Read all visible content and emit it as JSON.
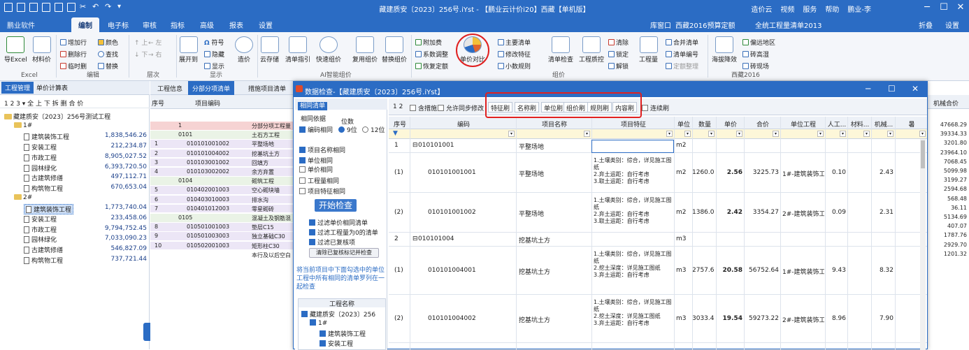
{
  "window": {
    "title": "藏建质安〔2023〕256号.iYst - 【鹏业云计价i20】西藏【单机版】",
    "right_items": [
      "造价云",
      "视频",
      "服务",
      "帮助",
      "鹏业-李"
    ]
  },
  "menu": {
    "logo": "鹏业软件",
    "tabs": [
      "编制",
      "电子标",
      "审核",
      "指标",
      "高级",
      "报表",
      "设置"
    ],
    "right": [
      "库窗口",
      "西藏2016预算定额",
      "全统工程量清单2013",
      "折叠",
      "设置"
    ]
  },
  "ribbon": {
    "excel": {
      "items": [
        "导Excel",
        "材料价"
      ],
      "group": "Excel"
    },
    "edit": {
      "items": [
        "增加行",
        "删除行",
        "临时删",
        "颜色",
        "查找",
        "替换"
      ],
      "group": "编辑"
    },
    "level": {
      "items": [
        "上",
        "下",
        "左",
        "右"
      ],
      "group": "层次"
    },
    "display": {
      "items": [
        "展开到",
        "符号",
        "隐藏",
        "显示"
      ],
      "group": "显示"
    },
    "price": {
      "items": [
        "造价"
      ]
    },
    "ai": {
      "items": [
        "云存储",
        "清单指引",
        "快速组价",
        "复用组价",
        "替换组价"
      ],
      "group": "AI智能组价"
    },
    "group_price": {
      "items": [
        "附加费",
        "系数调整",
        "恢复定额",
        "单价对比",
        "主要清单",
        "修改特征",
        "小数规则",
        "清单检查",
        "工程质控",
        "清除",
        "锁定",
        "解锁",
        "工程量",
        "合并清单",
        "清单编号",
        "定额整理"
      ],
      "group": "组价"
    },
    "xizang": {
      "items": [
        "海拔降效",
        "偏远地区",
        "砖高湿",
        "砖现场"
      ],
      "group": "西藏2016"
    }
  },
  "left_panel": {
    "tabs": [
      "工程管理",
      "单价计算表"
    ],
    "tools": "1 2 3 ▾ 全 上 下 拆 删 合 价",
    "tree": [
      {
        "label": "藏建质安〔2023〕256号测试工程",
        "amount": "",
        "indent": 0,
        "type": "folder"
      },
      {
        "label": "1#",
        "amount": "",
        "indent": 1,
        "type": "folder"
      },
      {
        "label": "建筑装饰工程",
        "amount": "1,838,546.26",
        "indent": 2,
        "type": "doc"
      },
      {
        "label": "安装工程",
        "amount": "212,234.87",
        "indent": 2,
        "type": "doc"
      },
      {
        "label": "市政工程",
        "amount": "8,905,027.52",
        "indent": 2,
        "type": "doc"
      },
      {
        "label": "园林绿化",
        "amount": "6,393,720.50",
        "indent": 2,
        "type": "doc"
      },
      {
        "label": "古建筑修缮",
        "amount": "497,112.71",
        "indent": 2,
        "type": "doc"
      },
      {
        "label": "构筑物工程",
        "amount": "670,653.04",
        "indent": 2,
        "type": "doc"
      },
      {
        "label": "2#",
        "amount": "",
        "indent": 1,
        "type": "folder"
      },
      {
        "label": "建筑装饰工程",
        "amount": "1,773,740.04",
        "indent": 2,
        "type": "doc",
        "selected": true
      },
      {
        "label": "安装工程",
        "amount": "233,458.06",
        "indent": 2,
        "type": "doc"
      },
      {
        "label": "市政工程",
        "amount": "9,794,752.45",
        "indent": 2,
        "type": "doc"
      },
      {
        "label": "园林绿化",
        "amount": "7,033,090.23",
        "indent": 2,
        "type": "doc"
      },
      {
        "label": "古建筑修缮",
        "amount": "546,827.09",
        "indent": 2,
        "type": "doc"
      },
      {
        "label": "构筑物工程",
        "amount": "737,721.44",
        "indent": 2,
        "type": "doc"
      }
    ]
  },
  "mid_panel": {
    "tabs": [
      "工程信息",
      "分部分项清单",
      "措施项目清单"
    ],
    "headers": [
      "序号",
      "项目编码"
    ],
    "rows": [
      {
        "seq": "",
        "code": "1",
        "name": "分部分项工程量"
      },
      {
        "seq": "",
        "code": "0101",
        "name": "土石方工程"
      },
      {
        "seq": "1",
        "code": "010101001002",
        "name": "平整场地"
      },
      {
        "seq": "2",
        "code": "010101004002",
        "name": "挖基坑土方"
      },
      {
        "seq": "3",
        "code": "010103001002",
        "name": "回填方"
      },
      {
        "seq": "4",
        "code": "010103002002",
        "name": "余方弃置"
      },
      {
        "seq": "",
        "code": "0104",
        "name": "砌筑工程"
      },
      {
        "seq": "5",
        "code": "010402001003",
        "name": "空心砌块墙"
      },
      {
        "seq": "6",
        "code": "010403010003",
        "name": "排水沟"
      },
      {
        "seq": "7",
        "code": "010401012003",
        "name": "零星砌砖"
      },
      {
        "seq": "",
        "code": "0105",
        "name": "混凝土及钢筋混"
      },
      {
        "seq": "8",
        "code": "010501001003",
        "name": "垫层C15"
      },
      {
        "seq": "9",
        "code": "010501003003",
        "name": "独立基础C30"
      },
      {
        "seq": "10",
        "code": "010502001003",
        "name": "矩形柱C30"
      },
      {
        "seq": "",
        "code": "",
        "name": "本行及以后空白"
      }
    ]
  },
  "right_strip": {
    "header": "机械合价",
    "values": [
      "47668.29",
      "39334.33",
      "3201.80",
      "23964.10",
      "7068.45",
      "5099.98",
      "3199.27",
      "2594.68",
      "568.48",
      "36.11",
      "5134.69",
      "407.07",
      "1787.76",
      "2929.70",
      "1201.32"
    ]
  },
  "dialog": {
    "title": "数据检查-【藏建质安〔2023〕256号.iYst】",
    "left": {
      "head": "相同清单",
      "basis": "相同依据",
      "code_same": "编码相同",
      "digits": "位数",
      "d9": "9位",
      "d12": "12位",
      "name_same": "项目名称相同",
      "unit_same": "单位相同",
      "price_same": "单价相同",
      "qty_same": "工程量相同",
      "feat_same": "项目特征相同",
      "start": "开始检查",
      "f1": "过滤单价相同清单",
      "f2": "过滤工程量为0的清单",
      "f3": "过滤已复核项",
      "clear": "清除已复核标记并检查",
      "hint": "将当前项目中下面勾选中的单位工程中所有相同的清单罗列在一起检查",
      "tree_head": "工程名称",
      "tree": [
        "藏建质安〔2023〕256",
        "1#",
        "建筑装饰工程",
        "安装工程"
      ]
    },
    "toolbar": {
      "levels": "1 2",
      "cb1": "含措施",
      "cb2": "允许同步修改",
      "brushes": [
        "特征刷",
        "名称刷",
        "单位刷",
        "组价刷",
        "规则刷",
        "内容刷"
      ],
      "cb3": "连续刷"
    },
    "headers": [
      "序号",
      "编码",
      "项目名称",
      "项目特征",
      "单位",
      "数量",
      "单价",
      "合价",
      "单位工程",
      "人工...",
      "材料...",
      "机械...",
      "暑"
    ],
    "rows": [
      {
        "type": "group",
        "seq": "1",
        "code": "010101001",
        "name": "平整场地",
        "feat": "",
        "unit": "m2"
      },
      {
        "type": "item",
        "seq": "(1)",
        "code": "010101001001",
        "name": "平整场地",
        "feat": "1.土壤类别：综合，详见施工图纸\n2.弃土运距：自行考虑\n3.取土运距：自行考虑",
        "unit": "m2",
        "qty": "1260.05",
        "price": "2.56",
        "total": "3225.73",
        "proj": "1#-建筑装饰工",
        "labor": "0.10",
        "mat": "",
        "mech": "2.43"
      },
      {
        "type": "item",
        "seq": "(2)",
        "code": "010101001002",
        "name": "平整场地",
        "feat": "1.土壤类别：综合，详见施工图纸\n2.弃土运距：自行考虑\n3.取土运距：自行考虑",
        "unit": "m2",
        "qty": "1386.06",
        "price": "2.42",
        "total": "3354.27",
        "proj": "2#-建筑装饰工",
        "labor": "0.09",
        "mat": "",
        "mech": "2.31"
      },
      {
        "type": "group",
        "seq": "2",
        "code": "010101004",
        "name": "挖基坑土方",
        "feat": "",
        "unit": "m3"
      },
      {
        "type": "item",
        "seq": "(1)",
        "code": "010101004001",
        "name": "挖基坑土方",
        "feat": "1.土壤类别：综合，详见施工图纸\n2.挖土深度：详见施工图纸\n3.弃土运距：自行考虑",
        "unit": "m3",
        "qty": "2757.66",
        "price": "20.58",
        "total": "56752.64",
        "proj": "1#-建筑装饰工",
        "labor": "9.43",
        "mat": "",
        "mech": "8.32"
      },
      {
        "type": "item",
        "seq": "(2)",
        "code": "010101004002",
        "name": "挖基坑土方",
        "feat": "1.土壤类别：综合，详见施工图纸\n2.挖土深度：详见施工图纸\n3.弃土运距：自行考虑",
        "unit": "m3",
        "qty": "3033.43",
        "price": "19.54",
        "total": "59273.22",
        "proj": "2#-建筑装饰工",
        "labor": "8.96",
        "mat": "",
        "mech": "7.90"
      }
    ]
  },
  "colors": {
    "accent": "#2b6cc4",
    "highlight_red": "#e02020"
  }
}
